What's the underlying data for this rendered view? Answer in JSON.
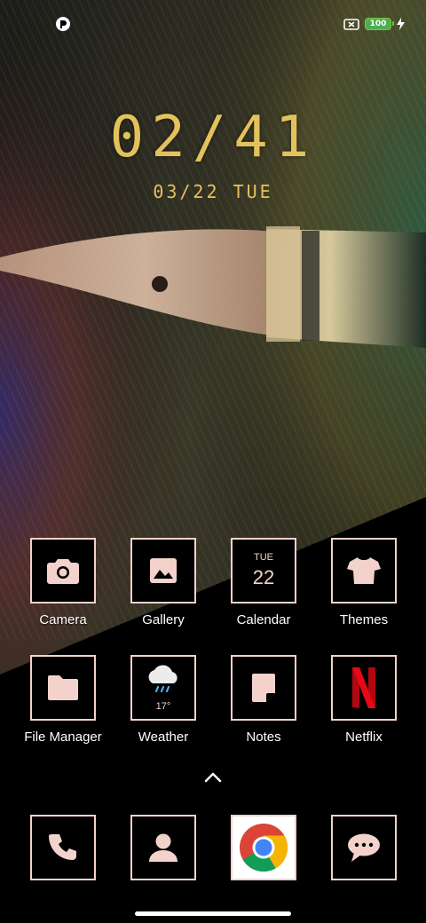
{
  "status_bar": {
    "left_icon": "notification-app-icon",
    "right_icons": [
      "no-sim-icon",
      "battery-icon",
      "charging-bolt-icon"
    ],
    "battery_level": "100"
  },
  "lock_clock": {
    "time": "02/41",
    "date": "03/22 TUE",
    "color": "#e3c15c"
  },
  "apps": [
    {
      "label": "Camera",
      "icon": "camera-icon"
    },
    {
      "label": "Gallery",
      "icon": "image-icon"
    },
    {
      "label": "Calendar",
      "icon": "calendar-icon",
      "day": "TUE",
      "date": "22"
    },
    {
      "label": "Themes",
      "icon": "tshirt-icon"
    },
    {
      "label": "File Manager",
      "icon": "folder-icon"
    },
    {
      "label": "Weather",
      "icon": "cloud-rain-icon",
      "temp": "17°"
    },
    {
      "label": "Notes",
      "icon": "note-icon"
    },
    {
      "label": "Netflix",
      "icon": "netflix-icon"
    }
  ],
  "dock": [
    {
      "name": "phone",
      "icon": "phone-icon"
    },
    {
      "name": "contacts",
      "icon": "contact-icon"
    },
    {
      "name": "chrome",
      "icon": "chrome-icon"
    },
    {
      "name": "messages",
      "icon": "chat-bubble-icon"
    }
  ],
  "theme": {
    "icon_accent": "#f3d2cb",
    "netflix_red": "#d81f26"
  }
}
